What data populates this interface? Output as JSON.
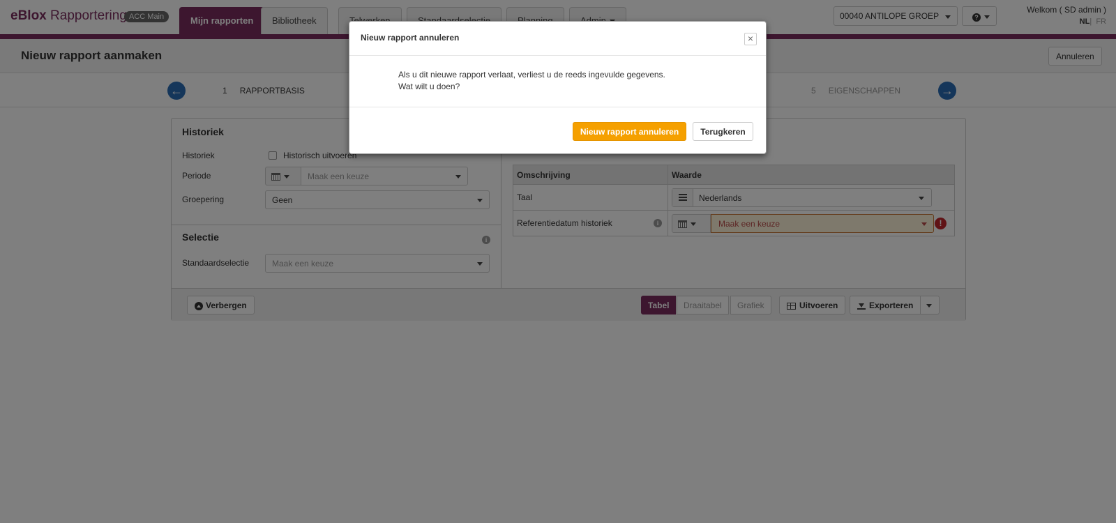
{
  "navbar": {
    "brand_bold": "eBlox",
    "brand_rest": "Rapportering",
    "badge": "ACC Main",
    "tabs": [
      {
        "label": "Mijn rapporten"
      },
      {
        "label": "Bibliotheek"
      },
      {
        "label": "Telwerken"
      },
      {
        "label": "Standaardselectie"
      },
      {
        "label": "Planning"
      },
      {
        "label": "Admin"
      }
    ],
    "organisation": "00040 ANTILOPE GROEP",
    "welcome": "Welkom ( SD admin )",
    "lang_active": "NL",
    "lang_sep": "|",
    "lang_other": "FR"
  },
  "header": {
    "title": "Nieuw rapport aanmaken",
    "cancel_label": "Annuleren"
  },
  "wizard": {
    "step_first_num": "1",
    "step_first_label": "RAPPORTBASIS",
    "step_last_num": "5",
    "step_last_label": "EIGENSCHAPPEN"
  },
  "historiek": {
    "title": "Historiek",
    "historiek_label": "Historiek",
    "checkbox_label": "Historisch uitvoeren",
    "periode_label": "Periode",
    "periode_placeholder": "Maak een keuze",
    "groepering_label": "Groepering",
    "groepering_value": "Geen"
  },
  "selectie": {
    "title": "Selectie",
    "std_label": "Standaardselectie",
    "std_placeholder": "Maak een keuze"
  },
  "properties": {
    "col_desc": "Omschrijving",
    "col_value": "Waarde",
    "rows": [
      {
        "label": "Taal",
        "value": "Nederlands"
      },
      {
        "label": "Referentiedatum historiek",
        "value": "Maak een keuze"
      }
    ]
  },
  "footer": {
    "hide_label": "Verbergen",
    "view_tabel": "Tabel",
    "view_draaitabel": "Draaitabel",
    "view_grafiek": "Grafiek",
    "run_label": "Uitvoeren",
    "export_label": "Exporteren"
  },
  "modal": {
    "title": "Nieuw rapport annuleren",
    "close": "×",
    "line1": "Als u dit nieuwe rapport verlaat, verliest u de reeds ingevulde gegevens.",
    "line2": "Wat wilt u doen?",
    "confirm_label": "Nieuw rapport annuleren",
    "back_label": "Terugkeren"
  },
  "colors": {
    "brand": "#7a2d5e",
    "confirm": "#f5a000",
    "nav_arrow": "#2a6db5",
    "error": "#c0262d"
  }
}
